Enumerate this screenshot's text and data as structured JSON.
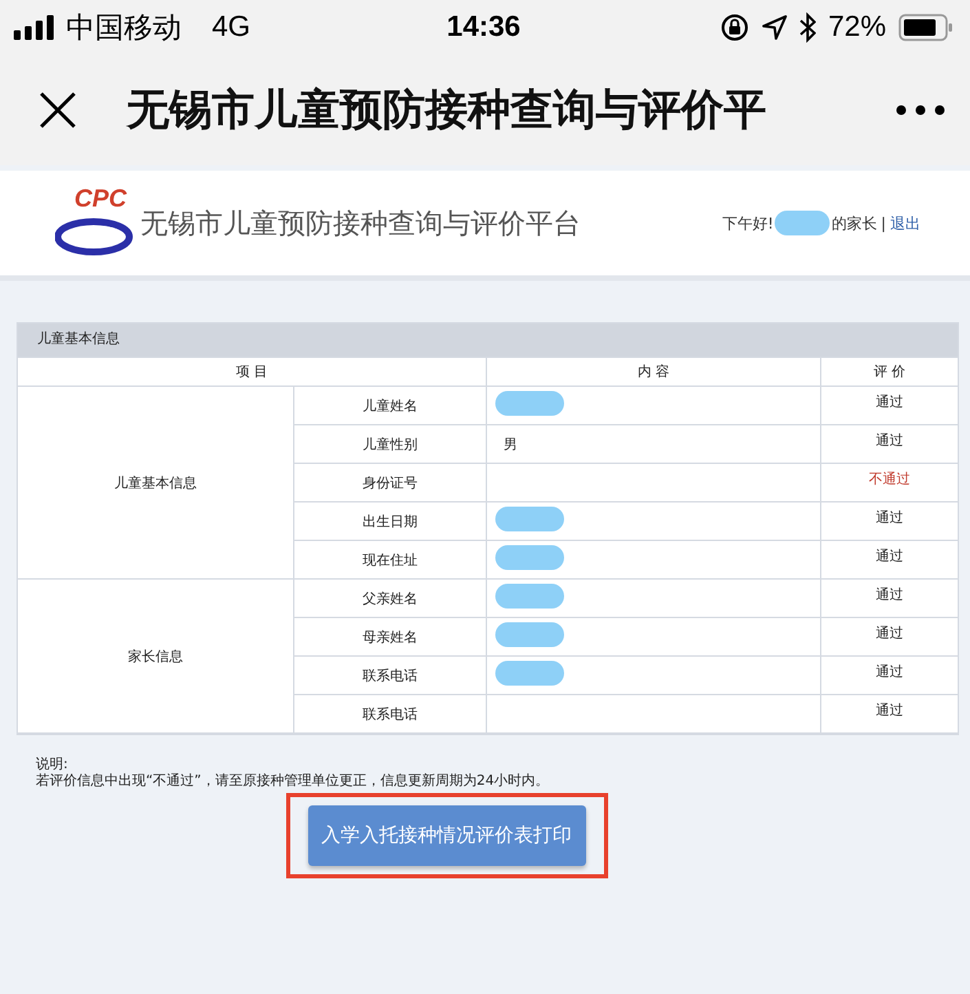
{
  "status_bar": {
    "carrier": "中国移动",
    "network": "4G",
    "time": "14:36",
    "battery": "72%"
  },
  "nav_bar": {
    "title": "无锡市儿童预防接种查询与评价平"
  },
  "site_header": {
    "logo_text": "CPC",
    "title": "无锡市儿童预防接种查询与评价平台",
    "greeting": "下午好!",
    "greeting_suffix": "的家长",
    "separator": "|",
    "logout": "退出",
    "name_redacted": true
  },
  "section": {
    "title": "儿童基本信息",
    "columns": [
      "项  目",
      "内  容",
      "评  价"
    ],
    "groups": [
      {
        "label": "儿童基本信息",
        "rows": [
          {
            "item": "儿童姓名",
            "content": "",
            "redacted": true,
            "rating": "通过",
            "passed": true
          },
          {
            "item": "儿童性别",
            "content": "男",
            "redacted": false,
            "rating": "通过",
            "passed": true
          },
          {
            "item": "身份证号",
            "content": "",
            "redacted": false,
            "rating": "不通过",
            "passed": false
          },
          {
            "item": "出生日期",
            "content": "",
            "redacted": true,
            "rating": "通过",
            "passed": true
          },
          {
            "item": "现在住址",
            "content": "",
            "redacted": true,
            "rating": "通过",
            "passed": true
          }
        ]
      },
      {
        "label": "家长信息",
        "rows": [
          {
            "item": "父亲姓名",
            "content": "",
            "redacted": true,
            "rating": "通过",
            "passed": true
          },
          {
            "item": "母亲姓名",
            "content": "",
            "redacted": true,
            "rating": "通过",
            "passed": true
          },
          {
            "item": "联系电话",
            "content": "",
            "redacted": true,
            "rating": "通过",
            "passed": true
          },
          {
            "item": "联系电话",
            "content": "",
            "redacted": false,
            "rating": "通过",
            "passed": true
          }
        ]
      }
    ]
  },
  "notes": {
    "title": "说明:",
    "text": "若评价信息中出现“不通过”，请至原接种管理单位更正，信息更新周期为24小时内。"
  },
  "print_button": {
    "label": "入学入托接种情况评价表打印",
    "highlighted": true
  }
}
